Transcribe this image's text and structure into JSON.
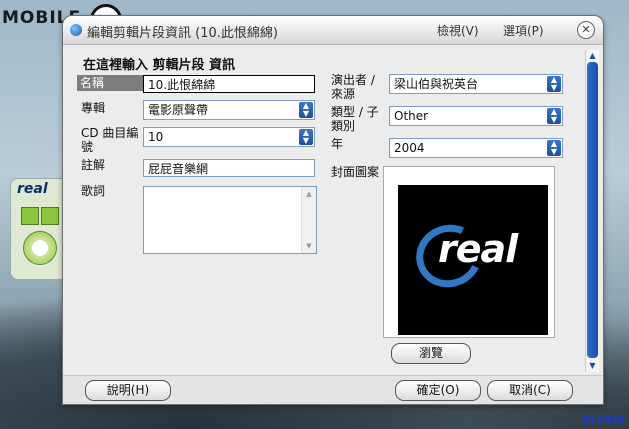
{
  "background": {
    "brand_text": "MOBILE",
    "watermark": "#12090",
    "mini_player_logo": "real"
  },
  "window": {
    "title": "編輯剪輯片段資訊 (10.此恨綿綿)",
    "menu_view": "檢視(V)",
    "menu_options": "選項(P)",
    "close_glyph": "✕"
  },
  "form": {
    "heading": "在這裡輸入 剪輯片段 資訊",
    "title_label": "名稱",
    "title_value": "10.此恨綿綿",
    "album_label": "專輯",
    "album_value": "電影原聲帶",
    "track_label": "CD 曲目編號",
    "track_value": "10",
    "comment_label": "註解",
    "comment_value": "屁屁音樂網",
    "lyrics_label": "歌詞",
    "lyrics_value": "",
    "artist_label": "演出者 / 來源",
    "artist_value": "梁山伯與祝英台",
    "genre_label": "類型 / 子類別",
    "genre_value": "Other",
    "year_label": "年",
    "year_value": "2004",
    "cover_label": "封面圖案",
    "cover_logo_text": "real",
    "browse_label": "瀏覽"
  },
  "footer": {
    "help_label": "說明(H)",
    "ok_label": "確定(O)",
    "cancel_label": "取消(C)"
  },
  "colors": {
    "accent": "#1b4f9e",
    "dialog_bg": "#ececec",
    "real_blue": "#2e78c5"
  }
}
